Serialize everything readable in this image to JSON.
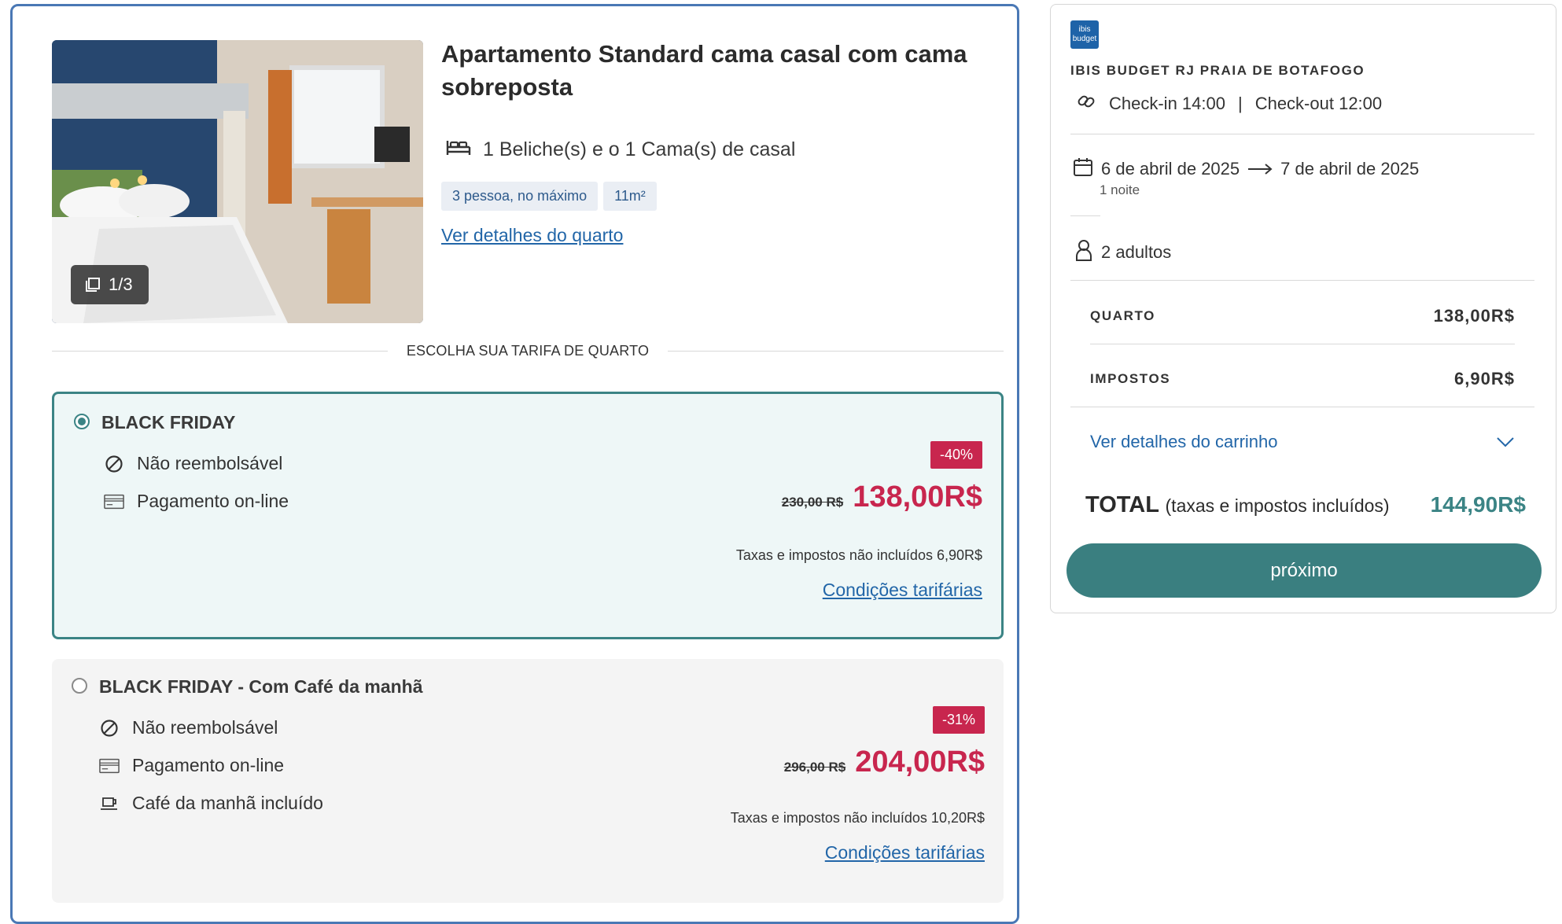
{
  "room": {
    "title": "Apartamento Standard cama casal com cama sobreposta",
    "beds": "1 Beliche(s) e o 1 Cama(s) de casal",
    "tags": [
      "3 pessoa, no máximo",
      "11m²"
    ],
    "details_link": "Ver detalhes do quarto",
    "photo_counter": "1/3"
  },
  "rates_heading": "ESCOLHA SUA TARIFA DE QUARTO",
  "rates": [
    {
      "name": "BLACK FRIDAY",
      "selected": true,
      "features": [
        "Não reembolsável",
        "Pagamento on-line"
      ],
      "discount": "-40%",
      "old_price": "230,00 R$",
      "price": "138,00R$",
      "tax_note": "Taxas e impostos não incluídos 6,90R$",
      "conditions": "Condições tarifárias"
    },
    {
      "name": "BLACK FRIDAY - Com Café da manhã",
      "selected": false,
      "features": [
        "Não reembolsável",
        "Pagamento on-line",
        "Café da manhã incluído"
      ],
      "discount": "-31%",
      "old_price": "296,00 R$",
      "price": "204,00R$",
      "tax_note": "Taxas e impostos não incluídos 10,20R$",
      "conditions": "Condições tarifárias"
    }
  ],
  "cart": {
    "logo_text": "ibis budget",
    "hotel_name": "IBIS BUDGET RJ PRAIA DE BOTAFOGO",
    "checkin": "Check-in 14:00",
    "separator": "|",
    "checkout": "Check-out 12:00",
    "date_from": "6 de abril de 2025",
    "date_to": "7 de abril de 2025",
    "nights": "1 noite",
    "guests": "2 adultos",
    "room_label": "QUARTO",
    "room_value": "138,00R$",
    "taxes_label": "IMPOSTOS",
    "taxes_value": "6,90R$",
    "details_link": "Ver detalhes do carrinho",
    "total_label": "TOTAL",
    "total_note": "(taxas e impostos incluídos)",
    "total_value": "144,90R$",
    "next_button": "próximo"
  },
  "colors": {
    "accent_teal": "#3b8485",
    "price_red": "#c8264e",
    "link_blue": "#2266a8",
    "card_border": "#4a78b5"
  }
}
